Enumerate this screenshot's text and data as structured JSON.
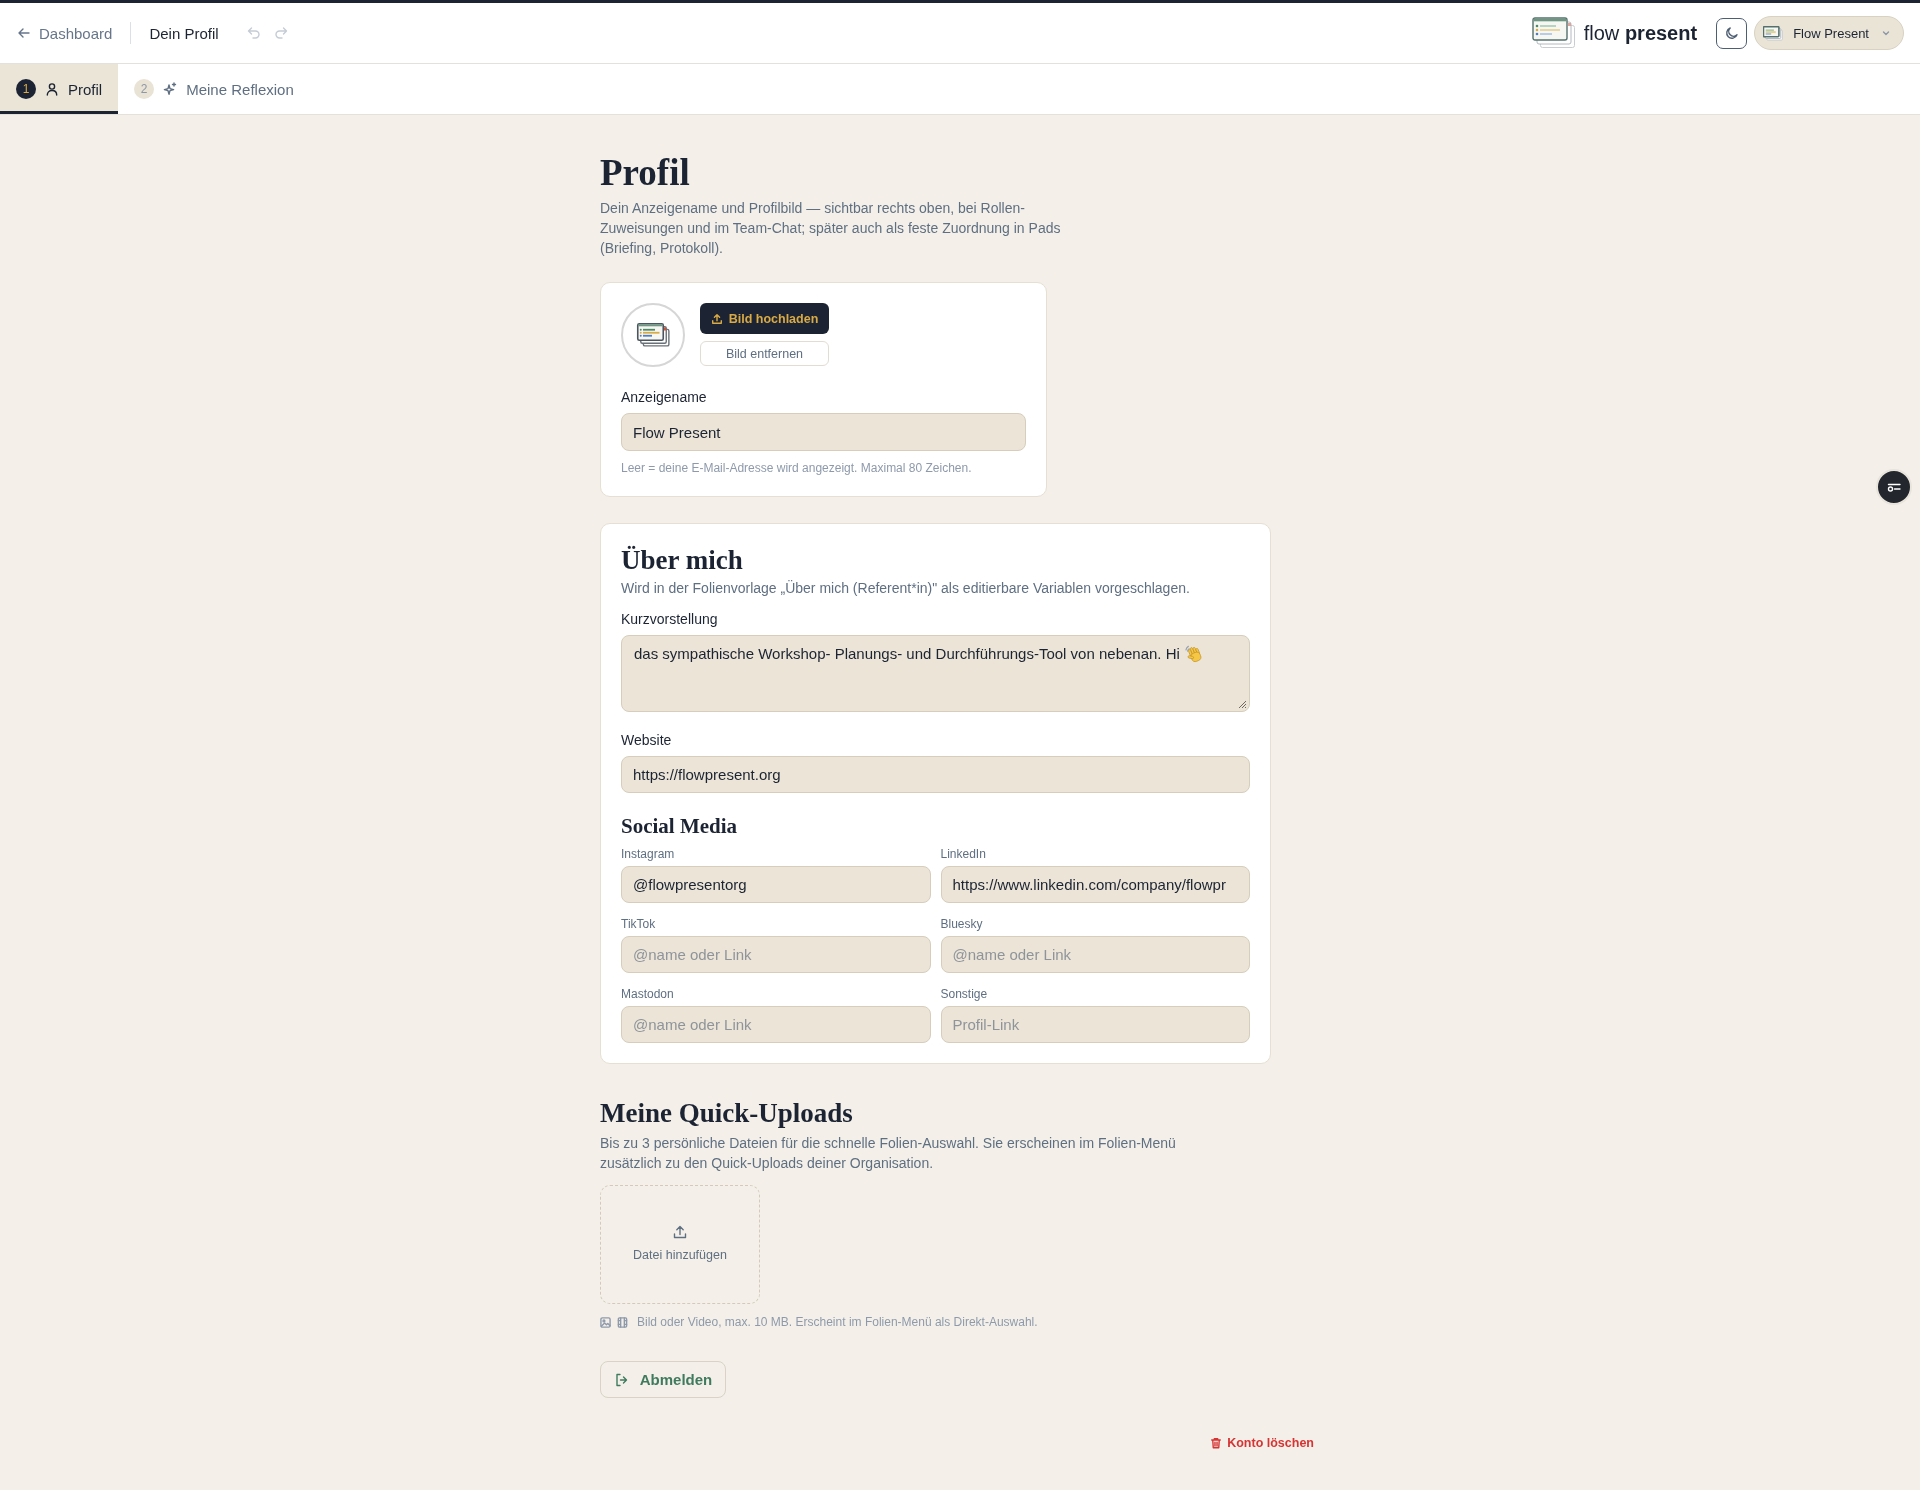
{
  "header": {
    "back_link": "Dashboard",
    "title": "Dein Profil",
    "undo_disabled": true,
    "redo_disabled": true,
    "brand": "flow **present**",
    "user_menu": "Flow Present"
  },
  "tabs": [
    {
      "number": "1",
      "label": "Profil",
      "selected": true
    },
    {
      "number": "2",
      "label": "Meine Reflexion",
      "selected": false
    }
  ],
  "profile": {
    "title": "Profil",
    "description": "Dein Anzeigename und Profilbild — sichtbar rechts oben, bei Rollen-Zuweisungen und im Team-Chat; später auch als feste Zuordnung in Pads (Briefing, Protokoll).",
    "upload_button": "Bild hochladen",
    "remove_button": "Bild entfernen",
    "display_name": {
      "label": "Anzeigename",
      "value": "Flow Present",
      "hint": "Leer = deine E-Mail-Adresse wird angezeigt. Maximal 80 Zeichen."
    }
  },
  "about": {
    "title": "Über mich",
    "description": "Wird in der Folienvorlage „Über mich (Referent*in)\" als editierbare Variablen vorgeschlagen.",
    "intro": {
      "label": "Kurzvorstellung",
      "value": "das sympathische Workshop- Planungs- und Durchführungs-Tool von nebenan. Hi"
    },
    "website": {
      "label": "Website",
      "value": "https://flowpresent.org"
    },
    "social": {
      "title": "Social Media",
      "fields": [
        {
          "label": "Instagram",
          "value": "@flowpresentorg"
        },
        {
          "label": "LinkedIn",
          "value": "https://www.linkedin.com/company/flowpr"
        },
        {
          "label": "TikTok",
          "placeholder": "@name oder Link"
        },
        {
          "label": "Bluesky",
          "placeholder": "@name oder Link"
        },
        {
          "label": "Mastodon",
          "placeholder": "@name oder Link"
        },
        {
          "label": "Sonstige",
          "placeholder": "Profil-Link"
        }
      ]
    }
  },
  "quick_uploads": {
    "title": "Meine Quick-Uploads",
    "description": "Bis zu 3 persönliche Dateien für die schnelle Folien-Auswahl. Sie erscheinen im Folien-Menü zusätzlich zu den Quick-Uploads deiner Organisation.",
    "dropzone": "Datei hinzufügen",
    "hint": "Bild oder Video, max. 10 MB. Erscheint im Folien-Menü als Direkt-Auswahl."
  },
  "logout_button": "Abmelden",
  "delete_account": "Konto löschen"
}
